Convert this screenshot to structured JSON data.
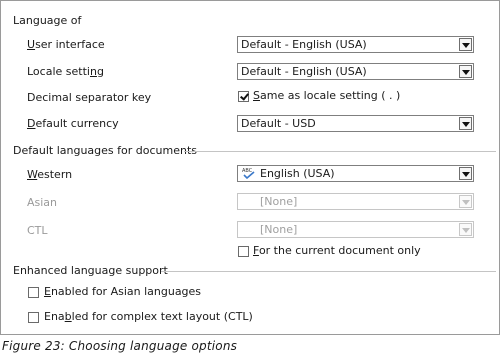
{
  "sections": {
    "language_of": "Language of",
    "default_languages": "Default languages for documents",
    "enhanced": "Enhanced language support"
  },
  "language_of": {
    "user_interface": {
      "label_u": "U",
      "label_rest": "ser interface",
      "value": "Default - English (USA)"
    },
    "locale_setting": {
      "label_pre": "Locale setti",
      "label_u": "n",
      "label_rest": "g",
      "value": "Default - English (USA)"
    },
    "decimal_separator": {
      "label": "Decimal separator key",
      "checkbox_u": "S",
      "checkbox_rest": "ame as locale setting ( . )",
      "checked": true
    },
    "default_currency": {
      "label_u": "D",
      "label_rest": "efault currency",
      "value": "Default - USD"
    }
  },
  "default_languages": {
    "western": {
      "label_u": "W",
      "label_rest": "estern",
      "value": "English (USA)",
      "icon": "spellcheck-abc-icon"
    },
    "asian": {
      "label": "Asian",
      "value": "[None]"
    },
    "ctl": {
      "label": "CTL",
      "value": "[None]"
    },
    "current_doc_only": {
      "label_u": "F",
      "label_rest": "or the current document only",
      "checked": false
    }
  },
  "enhanced": {
    "asian": {
      "label_pre": "",
      "label_u": "E",
      "label_rest": "nabled for Asian languages",
      "checked": false
    },
    "ctl": {
      "label_pre": "Ena",
      "label_u": "b",
      "label_rest": "led for complex text layout (CTL)",
      "checked": false
    }
  },
  "caption": "Figure 23: Choosing language options"
}
